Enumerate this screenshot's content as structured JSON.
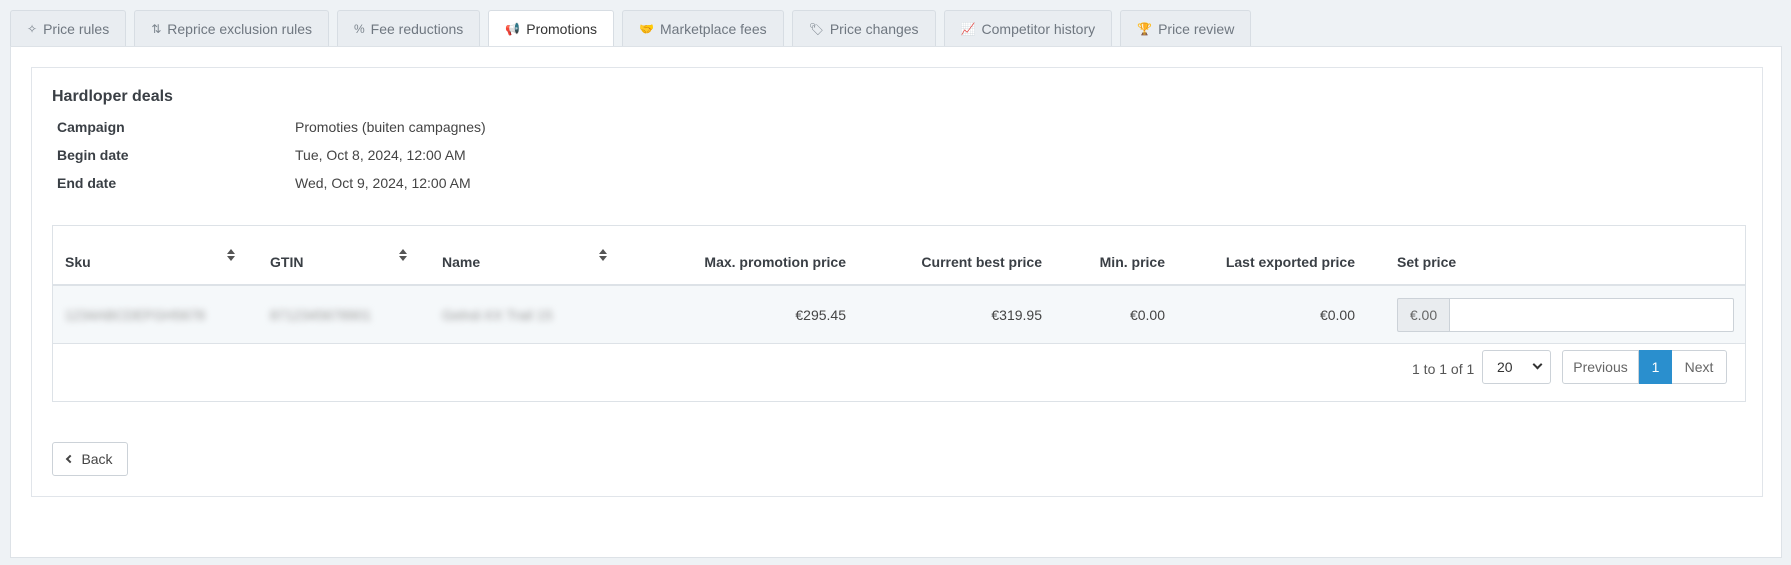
{
  "tabs": [
    {
      "label": "Price rules",
      "icon": "sparkle-icon",
      "glyph": "✧",
      "active": false
    },
    {
      "label": "Reprice exclusion rules",
      "icon": "sort-arrows-icon",
      "glyph": "⇅",
      "active": false
    },
    {
      "label": "Fee reductions",
      "icon": "percent-icon",
      "glyph": "%",
      "active": false
    },
    {
      "label": "Promotions",
      "icon": "megaphone-icon",
      "glyph": "📢",
      "active": true
    },
    {
      "label": "Marketplace fees",
      "icon": "handshake-icon",
      "glyph": "🤝",
      "active": false
    },
    {
      "label": "Price changes",
      "icon": "tag-icon",
      "glyph": "🏷",
      "active": false
    },
    {
      "label": "Competitor history",
      "icon": "line-chart-icon",
      "glyph": "📈",
      "active": false
    },
    {
      "label": "Price review",
      "icon": "trophy-icon",
      "glyph": "🏆",
      "active": false
    }
  ],
  "promotion": {
    "title": "Hardloper deals",
    "fields": [
      {
        "label": "Campaign",
        "value": "Promoties (buiten campagnes)"
      },
      {
        "label": "Begin date",
        "value": "Tue, Oct 8, 2024, 12:00 AM"
      },
      {
        "label": "End date",
        "value": "Wed, Oct 9, 2024, 12:00 AM"
      }
    ]
  },
  "table": {
    "columns": {
      "sku": "Sku",
      "gtin": "GTIN",
      "name": "Name",
      "max_promotion_price": "Max. promotion price",
      "current_best_price": "Current best price",
      "min_price": "Min. price",
      "last_exported_price": "Last exported price",
      "set_price": "Set price"
    },
    "rows": [
      {
        "sku": "1234ABCDEFGH5678",
        "gtin": "8712345678901",
        "name": "Gelnd-XX Trail 15",
        "max_promotion_price": "€295.45",
        "current_best_price": "€319.95",
        "min_price": "€0.00",
        "last_exported_price": "€0.00",
        "set_price_prefix": "€.00",
        "set_price_value": ""
      }
    ]
  },
  "pagination": {
    "info": "1 to 1 of 1",
    "page_size": "20",
    "previous": "Previous",
    "current_page": "1",
    "next": "Next"
  },
  "actions": {
    "back": "Back"
  },
  "colors": {
    "accent": "#2a8fce",
    "background": "#eef2f5"
  }
}
